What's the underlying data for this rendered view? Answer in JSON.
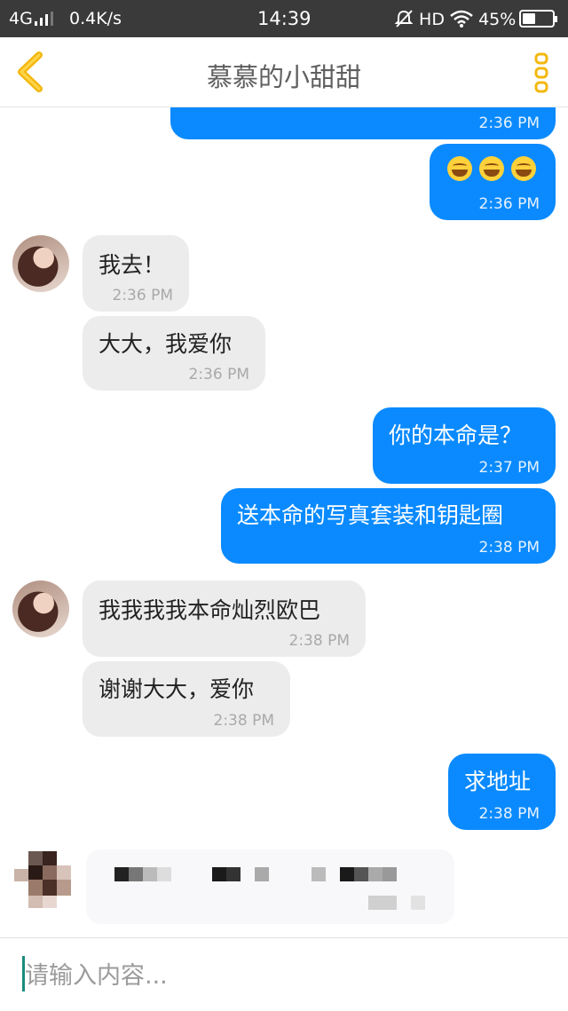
{
  "status_bar": {
    "network": "4G",
    "speed": "0.4K/s",
    "time": "14:39",
    "hd": "HD",
    "battery": "45%",
    "battery_level": 0.45
  },
  "header": {
    "title": "慕慕的小甜甜"
  },
  "colors": {
    "accent_yellow": "#f3b80f",
    "outgoing_bubble": "#0a8afe",
    "incoming_bubble": "#ececec"
  },
  "messages": [
    {
      "side": "out",
      "text": "",
      "time": "2:36 PM"
    },
    {
      "side": "out",
      "emoji": [
        "grin-sweat-emoji",
        "grin-sweat-emoji",
        "grin-sweat-emoji"
      ],
      "time": "2:36 PM"
    },
    {
      "side": "in",
      "text": "我去！",
      "time": "2:36 PM"
    },
    {
      "side": "in",
      "text": "大大，我爱你",
      "time": "2:36 PM"
    },
    {
      "side": "out",
      "text": "你的本命是？",
      "time": "2:37 PM"
    },
    {
      "side": "out",
      "text": "送本命的写真套装和钥匙圈",
      "time": "2:38 PM"
    },
    {
      "side": "in",
      "text": "我我我我本命灿烈欧巴",
      "time": "2:38 PM"
    },
    {
      "side": "in",
      "text": "谢谢大大，爱你",
      "time": "2:38 PM"
    },
    {
      "side": "out",
      "text": "求地址",
      "time": "2:38 PM"
    }
  ],
  "input": {
    "placeholder": "请输入内容..."
  }
}
